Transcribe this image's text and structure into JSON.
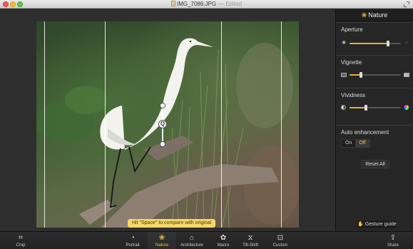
{
  "window": {
    "title": "IMG_7086.JPG",
    "title_suffix": "— Edited"
  },
  "canvas": {
    "hint": "Hit \"Space\" to compare with original",
    "tilt_handle_symbol": "Q"
  },
  "panel": {
    "header_icon": "nature-icon",
    "header_title": "Nature",
    "aperture": {
      "label": "Aperture",
      "value": 0.75,
      "icon_left": "aperture-small-icon",
      "icon_right": "aperture-large-icon"
    },
    "vignette": {
      "label": "Vignette",
      "value": 0.22,
      "icon_left": "vignette-dark-icon",
      "icon_right": "vignette-light-icon"
    },
    "vividness": {
      "label": "Vividness",
      "value": 0.32,
      "icon_left": "desaturated-icon",
      "icon_right": "colorful-icon"
    },
    "auto_enhancement": {
      "label": "Auto enhancement",
      "on_label": "On",
      "off_label": "Off",
      "selected": "Off"
    },
    "reset_label": "Reset All",
    "gesture_label": "Gesture guide"
  },
  "toolbar": {
    "items": [
      {
        "key": "crop",
        "label": "Crop",
        "icon": "crop-icon"
      },
      {
        "key": "portrait",
        "label": "Portrait",
        "icon": "portrait-icon"
      },
      {
        "key": "nature",
        "label": "Nature",
        "icon": "nature-icon"
      },
      {
        "key": "architecture",
        "label": "Architecture",
        "icon": "architecture-icon"
      },
      {
        "key": "macro",
        "label": "Macro",
        "icon": "macro-icon"
      },
      {
        "key": "tiltshift",
        "label": "Tilt-Shift",
        "icon": "tilt-shift-icon"
      },
      {
        "key": "custom",
        "label": "Custom",
        "icon": "custom-icon"
      },
      {
        "key": "share",
        "label": "Share",
        "icon": "share-icon"
      }
    ],
    "active": "Nature"
  },
  "colors": {
    "accent": "#f3c02a",
    "hint_background": "#f5d86a"
  }
}
